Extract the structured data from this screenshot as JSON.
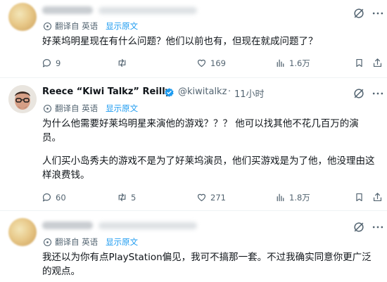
{
  "translate_label": "翻译自 英语",
  "show_original": "显示原文",
  "tweets": [
    {
      "body": "好莱坞明星现在有什么问题？他们以前也有，但现在就成问题了？",
      "replies": "9",
      "retweets": "",
      "likes": "169",
      "views": "1.6万"
    },
    {
      "name": "Reece “Kiwi Talkz” Reilly",
      "handle": "@kiwitalkz",
      "separator": "·",
      "time": "11小时",
      "body_p1": "为什么他需要好莱坞明星来演他的游戏？？？ 他可以找其他不花几百万的演员。",
      "body_p2": "人们买小岛秀夫的游戏不是为了好莱坞演员，他们买游戏是为了他，他没理由这样浪费钱。",
      "replies": "60",
      "retweets": "5",
      "likes": "271",
      "views": "1.8万"
    },
    {
      "body": "我还以为你有点PlayStation偏见，我可不搞那一套。不过我确实同意你更广泛的观点。"
    }
  ],
  "colors": {
    "accent": "#1d9bf0",
    "text": "#0f1419",
    "muted": "#536471",
    "divider": "#eff3f4"
  }
}
